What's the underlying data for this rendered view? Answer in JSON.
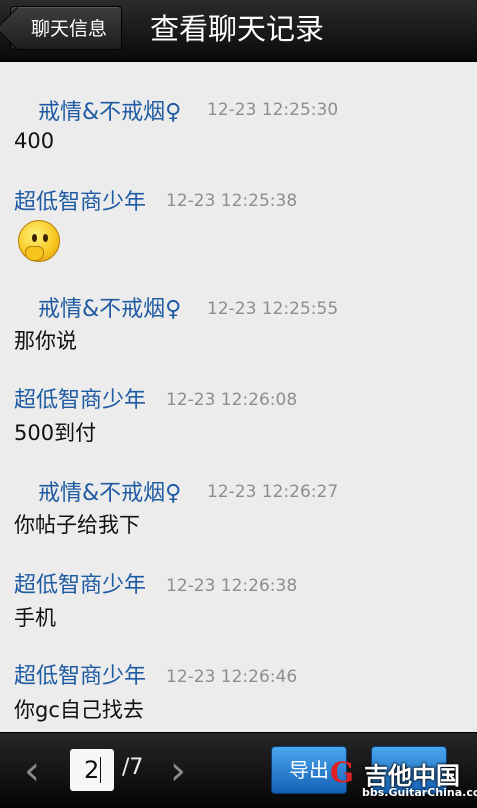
{
  "header": {
    "back_label": "聊天信息",
    "title": "查看聊天记录"
  },
  "messages": [
    {
      "sender": "戒情&不戒烟♀",
      "time": "12-23 12:25:30",
      "text": "400"
    },
    {
      "sender": "超低智商少年",
      "time": "12-23 12:25:38",
      "text": "",
      "emoji": "thinking-emoji"
    },
    {
      "sender": "戒情&不戒烟♀",
      "time": "12-23 12:25:55",
      "text": "那你说"
    },
    {
      "sender": "超低智商少年",
      "time": "12-23 12:26:08",
      "text": "500到付"
    },
    {
      "sender": "戒情&不戒烟♀",
      "time": "12-23 12:26:27",
      "text": "你帖子给我下"
    },
    {
      "sender": "超低智商少年",
      "time": "12-23 12:26:38",
      "text": "手机"
    },
    {
      "sender": "超低智商少年",
      "time": "12-23 12:26:46",
      "text": "你gc自己找去"
    }
  ],
  "pager": {
    "current_page": "2",
    "total_label": "/7",
    "prev_icon": "chevron-left-icon",
    "next_icon": "chevron-right-icon",
    "export_label": "导出"
  },
  "watermark": {
    "logo_letter": "G",
    "title": "吉他中国",
    "url": "bbs.GuitarChina.com"
  },
  "colors": {
    "sender_name": "#1f5ba3",
    "timestamp": "#8e8e8e",
    "bar_background": "#111111",
    "button_blue": "#2a86d6"
  }
}
